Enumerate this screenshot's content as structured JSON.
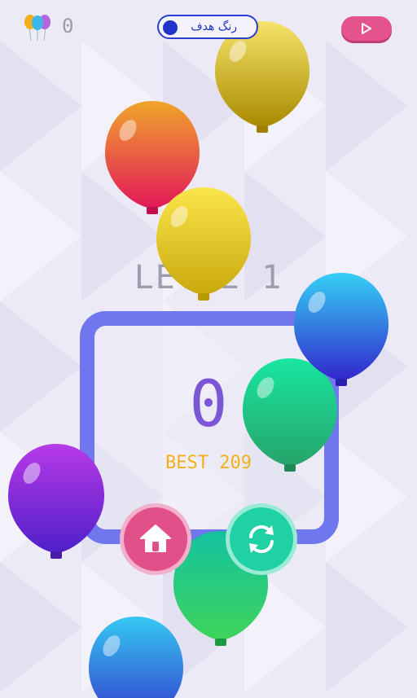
{
  "hud": {
    "balloons_icon": "balloons-icon",
    "popped_count": "0",
    "target_label": "رنگ هدف",
    "target_color": "#2233c8",
    "play_icon": "play-icon"
  },
  "game": {
    "level_label": "LEVEL 1",
    "score": "0",
    "best_label": "BEST 209"
  },
  "buttons": {
    "home_icon": "home-icon",
    "restart_icon": "restart-icon"
  },
  "colors": {
    "panel": "#6f76ee",
    "home": "#e2508a",
    "restart": "#1fd1a4",
    "best": "#f2b01e",
    "score": "#7b57d6"
  },
  "balloons": [
    {
      "color": "yellow"
    },
    {
      "color": "orange-red"
    },
    {
      "color": "yellow"
    },
    {
      "color": "blue"
    },
    {
      "color": "green"
    },
    {
      "color": "purple"
    },
    {
      "color": "green"
    },
    {
      "color": "blue"
    }
  ]
}
